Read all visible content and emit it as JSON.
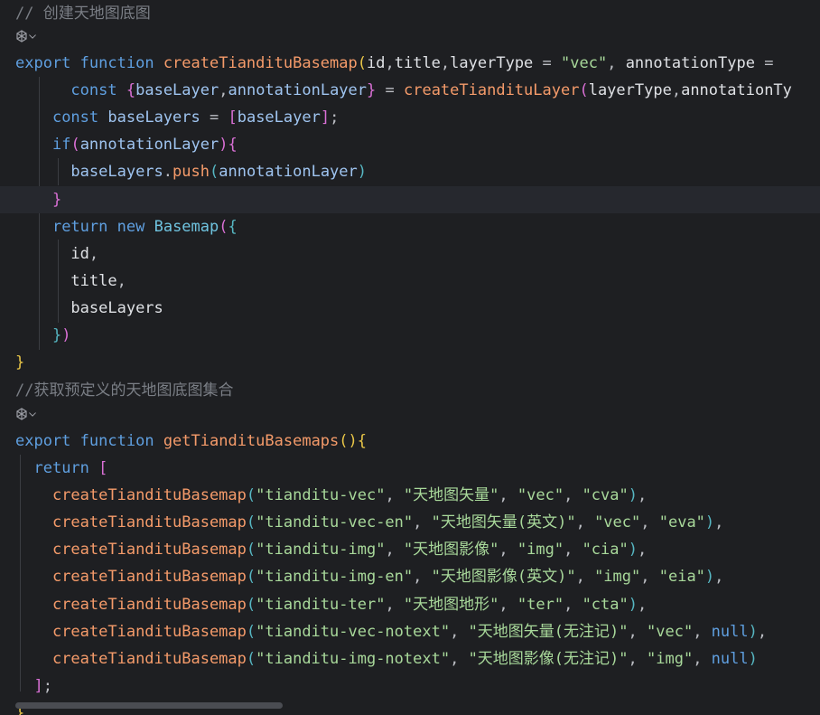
{
  "editor": {
    "comment_basemap": "// 创建天地图底图",
    "comment_collection": "//获取预定义的天地图底图集合",
    "fn1": {
      "export": "export",
      "function": "function",
      "name": "createTiandituBasemap",
      "params_a": "id",
      "params_b": "title",
      "params_c": "layerType",
      "eq": " = ",
      "default_vec": "\"vec\"",
      "params_d": "annotationType",
      "eq2": " = "
    },
    "l3": {
      "const": "const",
      "baseLayer": "baseLayer",
      "annotationLayer": "annotationLayer",
      "call": "createTiandituLayer",
      "arg1": "layerType",
      "arg2": "annotationTy"
    },
    "l4": {
      "const": "const",
      "name": "baseLayers",
      "item": "baseLayer"
    },
    "l5": {
      "if": "if",
      "cond": "annotationLayer"
    },
    "l6": {
      "obj": "baseLayers",
      "method": "push",
      "arg": "annotationLayer"
    },
    "l8": {
      "return": "return",
      "new": "new",
      "cls": "Basemap"
    },
    "props": [
      "id",
      "title",
      "baseLayers"
    ],
    "fn2": {
      "export": "export",
      "function": "function",
      "name": "getTiandituBasemaps",
      "return": "return"
    },
    "calls": [
      {
        "fn": "createTiandituBasemap",
        "id": "\"tianditu-vec\"",
        "title": "\"天地图矢量\"",
        "type": "\"vec\"",
        "anno": "\"cva\"",
        "end": ","
      },
      {
        "fn": "createTiandituBasemap",
        "id": "\"tianditu-vec-en\"",
        "title": "\"天地图矢量(英文)\"",
        "type": "\"vec\"",
        "anno": "\"eva\"",
        "end": ","
      },
      {
        "fn": "createTiandituBasemap",
        "id": "\"tianditu-img\"",
        "title": "\"天地图影像\"",
        "type": "\"img\"",
        "anno": "\"cia\"",
        "end": ","
      },
      {
        "fn": "createTiandituBasemap",
        "id": "\"tianditu-img-en\"",
        "title": "\"天地图影像(英文)\"",
        "type": "\"img\"",
        "anno": "\"eia\"",
        "end": ","
      },
      {
        "fn": "createTiandituBasemap",
        "id": "\"tianditu-ter\"",
        "title": "\"天地图地形\"",
        "type": "\"ter\"",
        "anno": "\"cta\"",
        "end": ","
      },
      {
        "fn": "createTiandituBasemap",
        "id": "\"tianditu-vec-notext\"",
        "title": "\"天地图矢量(无注记)\"",
        "type": "\"vec\"",
        "anno": "null",
        "end": ","
      },
      {
        "fn": "createTiandituBasemap",
        "id": "\"tianditu-img-notext\"",
        "title": "\"天地图影像(无注记)\"",
        "type": "\"img\"",
        "anno": "null",
        "end": ""
      }
    ]
  }
}
